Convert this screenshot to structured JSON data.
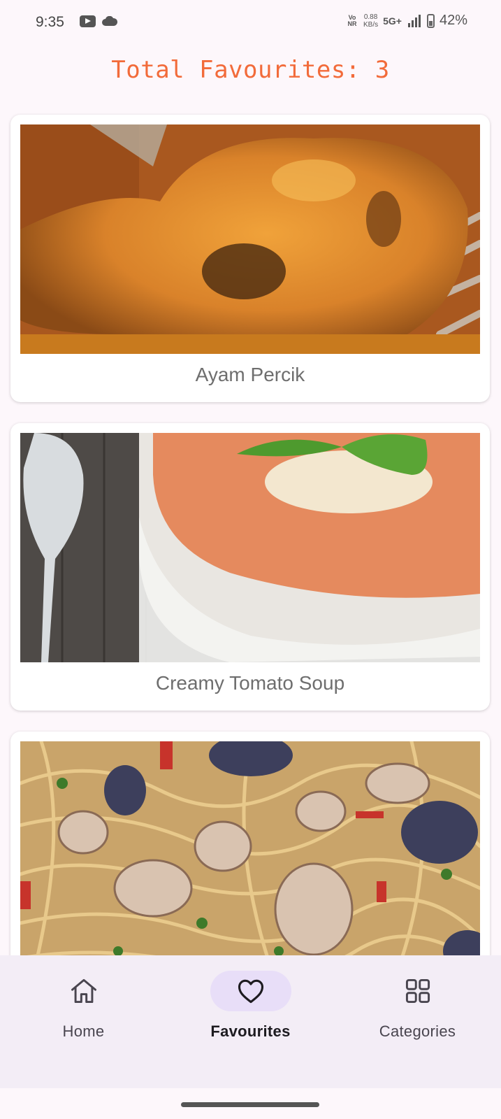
{
  "status_bar": {
    "time": "9:35",
    "volte_line1": "Vo",
    "volte_line2": "NR",
    "speed_value": "0.88",
    "speed_unit": "KB/s",
    "network": "5G+",
    "battery": "42%",
    "icons": [
      "youtube-icon",
      "cloud-icon",
      "signal-icon",
      "battery-icon"
    ]
  },
  "header": {
    "title": "Total Favourites: 3"
  },
  "favourites": [
    {
      "title": "Ayam Percik",
      "image": "fried-chicken-photo"
    },
    {
      "title": "Creamy Tomato Soup",
      "image": "tomato-soup-photo"
    },
    {
      "title": "",
      "image": "clam-spaghetti-photo"
    }
  ],
  "bottom_nav": {
    "items": [
      {
        "label": "Home",
        "icon": "home-icon",
        "active": false
      },
      {
        "label": "Favourites",
        "icon": "heart-icon",
        "active": true
      },
      {
        "label": "Categories",
        "icon": "grid-icon",
        "active": false
      }
    ]
  },
  "colors": {
    "title": "#f26b3a",
    "nav_active_pill": "#e8def8",
    "nav_background": "#f3edf6",
    "page_background": "#fdf7fb"
  }
}
